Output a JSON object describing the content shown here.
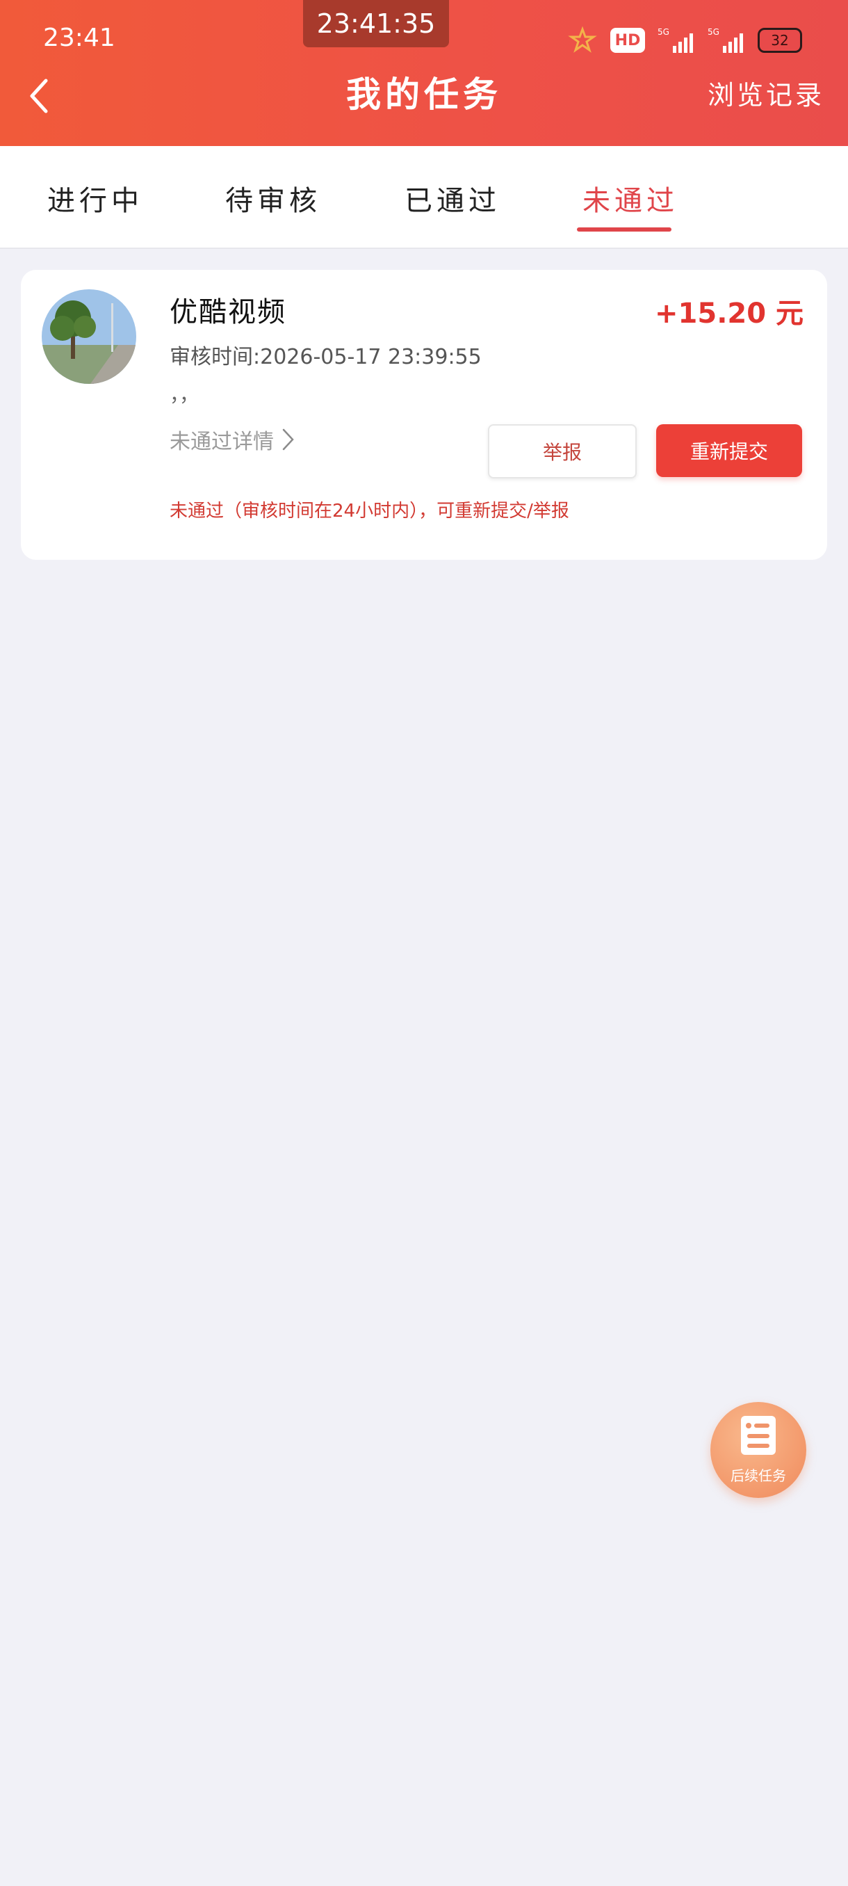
{
  "status_bar": {
    "time": "23:41",
    "clock": "23:41:35",
    "hd_label": "HD",
    "network_1": "5G",
    "network_2": "5G",
    "battery": "32"
  },
  "header": {
    "title": "我的任务",
    "history_label": "浏览记录"
  },
  "tabs": [
    {
      "label": "进行中"
    },
    {
      "label": "待审核"
    },
    {
      "label": "已通过"
    },
    {
      "label": "未通过"
    }
  ],
  "active_tab": "未通过",
  "task": {
    "name": "优酷视频",
    "reward": "+15.20 元",
    "review_time": "审核时间:2026-05-17  23:39:55",
    "comma_text": "，，",
    "fail_detail_label": "未通过详情",
    "report_label": "举报",
    "resubmit_label": "重新提交",
    "fail_notice": "未通过（审核时间在24小时内），可重新提交/举报"
  },
  "fab": {
    "label": "后续任务",
    "icon": "list-document-icon"
  },
  "colors": {
    "brand": "#ee5147",
    "accent_red": "#e1342f",
    "fab_orange": "#f08a5c"
  }
}
